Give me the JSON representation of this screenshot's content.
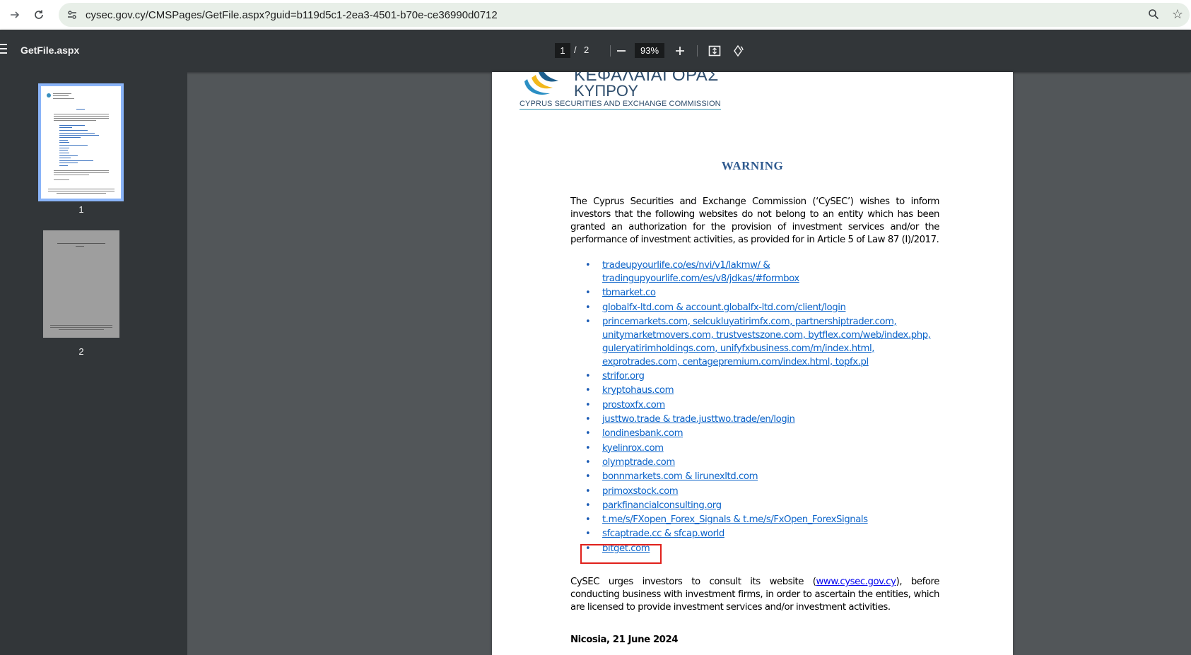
{
  "browser": {
    "url": "cysec.gov.cy/CMSPages/GetFile.aspx?guid=b119d5c1-2ea3-4501-b70e-ce36990d0712",
    "icons": [
      "forward-icon",
      "reload-icon",
      "site-info-icon",
      "zoom-icon",
      "bookmark-star-icon"
    ]
  },
  "pdf_toolbar": {
    "file_title": "GetFile.aspx",
    "current_page": "1",
    "page_separator": "/",
    "total_pages": "2",
    "zoom": "93%",
    "icons": [
      "menu-icon",
      "zoom-out-icon",
      "zoom-in-icon",
      "fit-page-icon",
      "rotate-icon"
    ]
  },
  "sidebar": {
    "thumbnails": [
      {
        "label": "1",
        "active": true
      },
      {
        "label": "2",
        "active": false
      }
    ]
  },
  "document": {
    "logo_line1": "ΚΕΦΑΛΑΙΑΓΟΡΑΣ",
    "logo_line2": "ΚΥΠΡΟΥ",
    "logo_subtitle": "CYPRUS SECURITIES AND EXCHANGE COMMISSION",
    "title": "WARNING",
    "intro": "The Cyprus Securities and Exchange Commission (‘CySEC’) wishes to inform investors that the following websites do not belong to an entity which has been granted an authorization for the provision of investment services and/or the performance of investment activities, as provided for in Article 5 of Law 87 (I)/2017.",
    "websites": [
      "tradeupyourlife.co/es/nvi/v1/lakmw/ & tradingupyourlife.com/es/v8/jdkas/#formbox",
      "tbmarket.co",
      "globalfx-ltd.com & account.globalfx-ltd.com/client/login",
      "princemarkets.com, selcukluyatirimfx.com, partnershiptrader.com, unitymarketmovers.com, trustvestszone.com, bytflex.com/web/index.php, guleryatirimholdings.com, unifyfxbusiness.com/m/index.html, exprotrades.com, centagepremium.com/index.html, topfx.pl",
      "strifor.org",
      "kryptohaus.com",
      "prostoxfx.com",
      "justtwo.trade & trade.justtwo.trade/en/login",
      "londinesbank.com",
      "kyelinrox.com",
      "olymptrade.com",
      "bonnmarkets.com & lirunexltd.com",
      "primoxstock.com",
      "parkfinancialconsulting.org",
      "t.me/s/FXopen_Forex_Signals & t.me/s/FxOpen_ForexSignals",
      "sfcaptrade.cc & sfcap.world",
      "bitget.com"
    ],
    "bullet": "•",
    "outro_before": "CySEC urges investors to consult its website (",
    "outro_link": "www.cysec.gov.cy",
    "outro_after": "), before conducting business with investment firms, in order to ascertain the entities, which are licensed to provide investment services and/or investment activities.",
    "signoff": "Nicosia, 21 June 2024"
  },
  "colors": {
    "highlight": "#e0201b",
    "link": "#0b63c9",
    "title": "#2f5a8f",
    "toolbar": "#323639"
  }
}
